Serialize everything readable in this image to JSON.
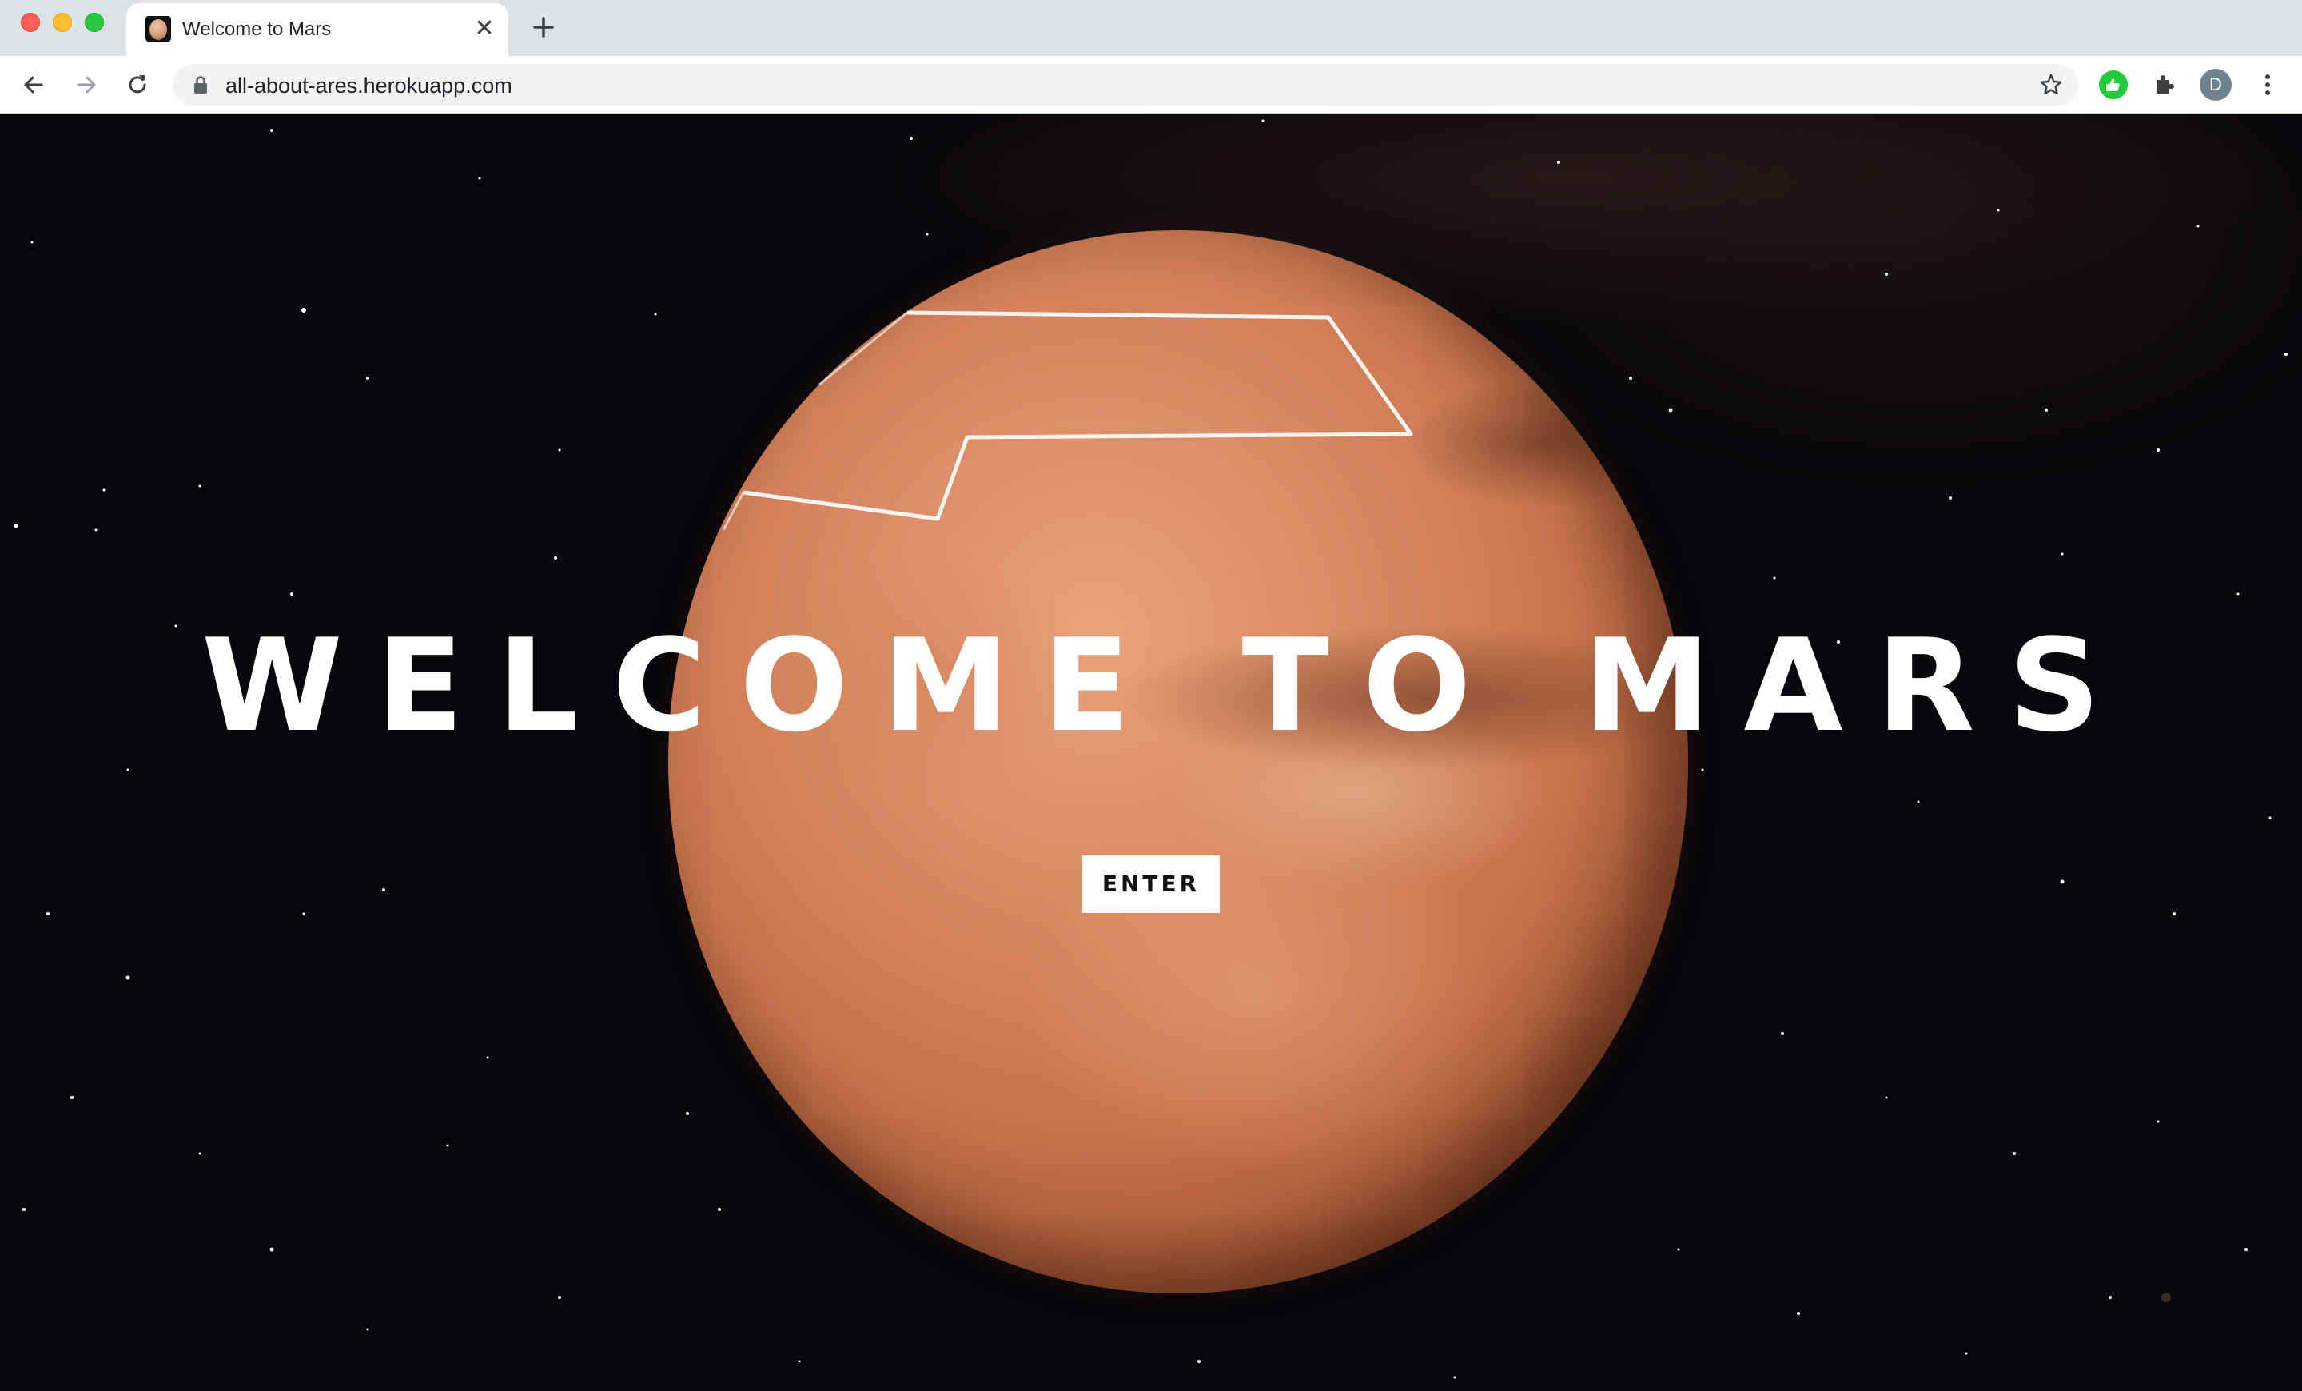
{
  "browser": {
    "tab": {
      "title": "Welcome to Mars",
      "close_icon": "close-icon",
      "favicon": "mars-favicon"
    },
    "new_tab_icon": "plus-icon",
    "toolbar": {
      "back_icon": "arrow-left-icon",
      "forward_icon": "arrow-right-icon",
      "reload_icon": "reload-icon",
      "url": "all-about-ares.herokuapp.com",
      "lock_icon": "lock-icon",
      "bookmark_icon": "star-icon",
      "extension_icon": "green-extension-icon",
      "extensions_icon": "puzzle-icon",
      "profile_initial": "D",
      "menu_icon": "vertical-dots-icon"
    }
  },
  "hero": {
    "title": "WELCOME TO MARS",
    "enter_label": "ENTER"
  },
  "colors": {
    "tabstrip": "#dee1e6",
    "page_background": "#07060a",
    "planet": "#d98a63",
    "title_text": "#ffffff",
    "button_background": "#ffffff",
    "avatar": "#6e8390",
    "extension_green": "#1fcb3a"
  }
}
